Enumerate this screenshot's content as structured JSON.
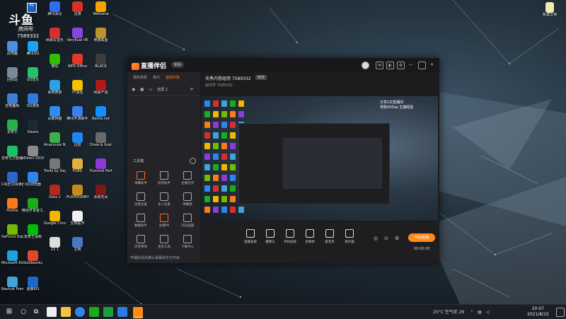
{
  "desktop": {
    "brand": {
      "badge": "PC",
      "text": "斗鱼",
      "sub1": "房间号",
      "sub2": "7589332"
    },
    "icons_col1": [
      {
        "label": "此电脑",
        "color": "#4a8fe0"
      },
      {
        "label": "回收站",
        "color": "#7b8a99"
      },
      {
        "label": "控制面板",
        "color": "#3f7ed8"
      },
      {
        "label": "爱奇艺",
        "color": "#27b34a"
      },
      {
        "label": "爱奇艺万能播放器",
        "color": "#19c265"
      },
      {
        "label": "CAJ全文阅读器",
        "color": "#2a66c7"
      },
      {
        "label": "Firefox",
        "color": "#ff7a1a"
      },
      {
        "label": "GeForce Experience",
        "color": "#76b900"
      },
      {
        "label": "Microsoft Edge",
        "color": "#1fa2e0"
      },
      {
        "label": "Navicat Premium 12",
        "color": "#41a3d8"
      }
    ],
    "icons_col2": [
      {
        "label": "腾讯QQ",
        "color": "#1ea1f2"
      },
      {
        "label": "QQ音乐",
        "color": "#22c36a"
      },
      {
        "label": "QQ游戏",
        "color": "#2e7be0"
      },
      {
        "label": "Steam",
        "color": "#1b2838"
      },
      {
        "label": "zDirect 2016 1",
        "color": "#8a8a8a"
      },
      {
        "label": "QQ浏览器",
        "color": "#2f86e8"
      },
      {
        "label": "微信开发者工具",
        "color": "#1aad19"
      },
      {
        "label": "爱奇艺视频",
        "color": "#00be06"
      },
      {
        "label": "Solidworks",
        "color": "#e0482a"
      },
      {
        "label": "金蝶KIS",
        "color": "#1c67c8"
      }
    ],
    "icons_col3": [
      {
        "label": "腾讯会议",
        "color": "#2e6ef0"
      },
      {
        "label": "网易云音乐",
        "color": "#d62f2f"
      },
      {
        "label": "微信",
        "color": "#2dc100"
      },
      {
        "label": "系统修复",
        "color": "#2ea0e6"
      },
      {
        "label": "百度网盘",
        "color": "#2c8ef0"
      },
      {
        "label": "Anaconda Navigator",
        "color": "#3faf4a"
      },
      {
        "label": "Trello by Daylight",
        "color": "#777"
      },
      {
        "label": "Dota 2",
        "color": "#b22a1e"
      },
      {
        "label": "Google Chrome",
        "color": "#f2b600"
      },
      {
        "label": "22 1",
        "color": "#ddd"
      }
    ],
    "icons_col4": [
      {
        "label": "迅游",
        "color": "#d93025"
      },
      {
        "label": "VeryKuai VK",
        "color": "#8844dd"
      },
      {
        "label": "WPS Office",
        "color": "#e3372a"
      },
      {
        "label": "YY语音",
        "color": "#f5c000"
      },
      {
        "label": "腾讯手游助手",
        "color": "#3b7ef0"
      },
      {
        "label": "迅雷",
        "color": "#1d86f0"
      },
      {
        "label": "PUBG",
        "color": "#e0b33a"
      },
      {
        "label": "PLAYERUNKNOWN'S BATTLEGROUNDS",
        "color": "#c98a1b"
      },
      {
        "label": "生物医学",
        "color": "#f0f0f0"
      },
      {
        "label": "文档",
        "color": "#4a78c8"
      }
    ],
    "icons_col5": [
      {
        "label": "WeGame",
        "color": "#f4a300"
      },
      {
        "label": "英雄联盟",
        "color": "#b9942f"
      },
      {
        "label": "BLACK",
        "color": "#3d3d3d"
      },
      {
        "label": "网易严选",
        "color": "#b11a1a"
      },
      {
        "label": "Battle.net",
        "color": "#148eff"
      },
      {
        "label": "Draw & Guess",
        "color": "#6a6a6a"
      },
      {
        "label": "Pummel Party",
        "color": "#8a3bd8"
      },
      {
        "label": "永劫无间",
        "color": "#7a1a1a"
      }
    ],
    "file_top_right": {
      "label": "新建文档",
      "color": "#f3e9b5"
    }
  },
  "app": {
    "logo": "直播伴侣",
    "version": "新版",
    "left_tabs": [
      "我的场景",
      "观众",
      "虚拟形象"
    ],
    "scene_label": "全屏 2",
    "tools_title": "工具箱",
    "tools": [
      {
        "label": "弹幕助手",
        "color": "#ff6a2a"
      },
      {
        "label": "房管助手",
        "color": "#aaa"
      },
      {
        "label": "主播任务",
        "color": "#aaa"
      },
      {
        "label": "玩家连麦",
        "color": "#aaa"
      },
      {
        "label": "多人连麦",
        "color": "#aaa"
      },
      {
        "label": "弹幕库",
        "color": "#aaa"
      },
      {
        "label": "数据助手",
        "color": "#aaa"
      },
      {
        "label": "主播PK",
        "color": "#ff6a2a"
      },
      {
        "label": "闪光画面",
        "color": "#aaa"
      },
      {
        "label": "声音特效",
        "color": "#aaa"
      },
      {
        "label": "更多工具",
        "color": "#aaa"
      },
      {
        "label": "下载中心",
        "color": "#aaa"
      }
    ],
    "room_title": "天秀内卷组用 7589332",
    "room_tag": "修改",
    "room_sub": "房间号 7589332",
    "preview_notice": [
      "分享1次直播间",
      "奖励500xp 主播经验"
    ],
    "controls": [
      {
        "label": "直播录屏"
      },
      {
        "label": "摄像头"
      },
      {
        "label": "手机投屏"
      },
      {
        "label": "多媒体"
      },
      {
        "label": "麦克风"
      },
      {
        "label": "扬声器"
      }
    ],
    "start_label": "开始直播",
    "timer": "00:00:00",
    "footnote": "开播前请先确认弹幕助手已开启"
  },
  "taskbar": {
    "tray_text": "25°C 空气优 26",
    "time": "20:07",
    "date": "2021/8/15"
  }
}
